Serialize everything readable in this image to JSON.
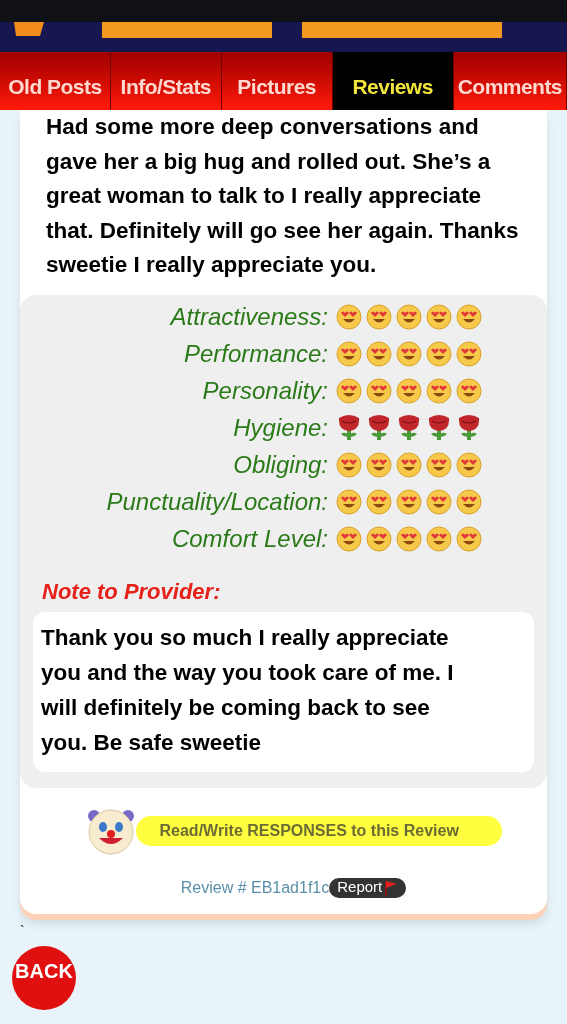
{
  "tabs": [
    {
      "label": "Old Posts",
      "selected": false
    },
    {
      "label": "Info/Stats",
      "selected": false
    },
    {
      "label": "Pictures",
      "selected": false
    },
    {
      "label": "Reviews",
      "selected": true
    },
    {
      "label": "Comments",
      "selected": false
    }
  ],
  "review_text": "Had some more deep conversations and gave her a big hug and rolled out. She’s a great woman to talk to I really appreciate that. Definitely will go see her again. Thanks sweetie I really appreciate you.",
  "ratings": [
    {
      "label": "Attractiveness:",
      "kind": "face",
      "stars": 5
    },
    {
      "label": "Performance:",
      "kind": "face",
      "stars": 5
    },
    {
      "label": "Personality:",
      "kind": "face",
      "stars": 5
    },
    {
      "label": "Hygiene:",
      "kind": "rose",
      "stars": 5
    },
    {
      "label": "Obliging:",
      "kind": "face",
      "stars": 5
    },
    {
      "label": "Punctuality/Location:",
      "kind": "face",
      "stars": 5
    },
    {
      "label": "Comfort Level:",
      "kind": "face",
      "stars": 5
    }
  ],
  "note": {
    "heading": "Note to Provider:",
    "text": "Thank you so much I really appreciate you and the way you took care of me. I will definitely be coming back to see you. Be safe sweetie"
  },
  "responses_button": "Read/Write RESPONSES to this Review",
  "review_id": "Review # EB1ad1f1c",
  "report_button": "Report",
  "stray_mark": "`",
  "back_button": "BACK"
}
